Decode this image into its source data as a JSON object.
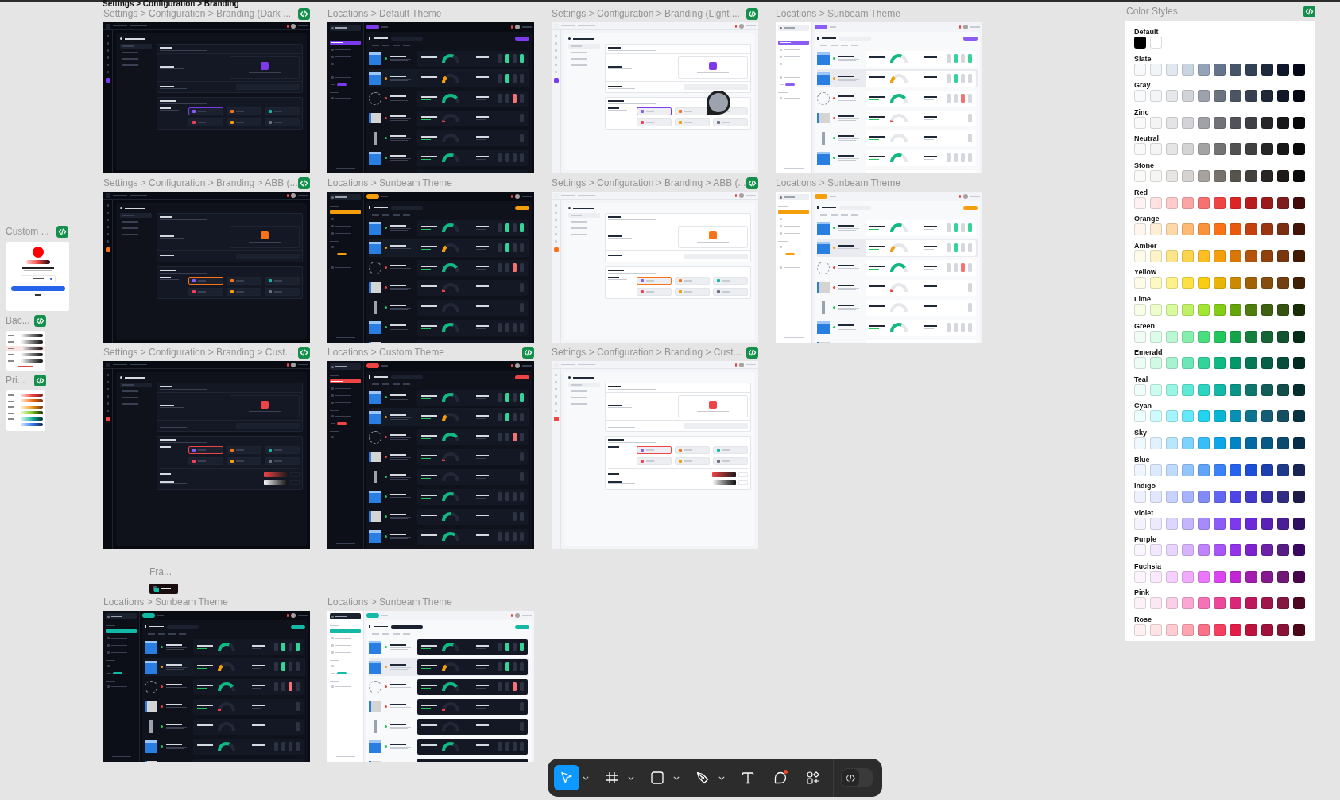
{
  "section_title": "Settings > Configuration > Branding",
  "rows": [
    {
      "frames": [
        {
          "title": "Settings > Configuration > Branding (Dark ...",
          "kind": "settings",
          "dark": true,
          "dark_cards": true,
          "color": "#7c3aed",
          "code": true,
          "collaborator": false,
          "extended": false
        },
        {
          "title": "Locations > Default Theme",
          "kind": "locations",
          "dark": true,
          "dark_cards": true,
          "color": "#7c3aed",
          "code": false,
          "collaborator": false,
          "extended": false
        },
        {
          "title": "Settings > Configuration > Branding (Light ...",
          "kind": "settings",
          "dark": false,
          "dark_cards": false,
          "color": "#7c3aed",
          "code": true,
          "collaborator": true,
          "extended": false
        },
        {
          "title": "Locations > Sunbeam Theme",
          "kind": "locations",
          "dark": false,
          "dark_cards": false,
          "color": "#8b5cf6",
          "code": false,
          "collaborator": false,
          "extended": false
        }
      ]
    },
    {
      "frames": [
        {
          "title": "Settings > Configuration > Branding > ABB (...",
          "kind": "settings",
          "dark": true,
          "dark_cards": true,
          "color": "#f97316",
          "code": true,
          "collaborator": false,
          "extended": false
        },
        {
          "title": "Locations > Sunbeam Theme",
          "kind": "locations",
          "dark": true,
          "dark_cards": true,
          "color": "#f59e0b",
          "code": false,
          "collaborator": false,
          "extended": false
        },
        {
          "title": "Settings > Configuration > Branding > ABB (...",
          "kind": "settings",
          "dark": false,
          "dark_cards": false,
          "color": "#f97316",
          "code": true,
          "collaborator": false,
          "extended": false
        },
        {
          "title": "Locations > Sunbeam Theme",
          "kind": "locations",
          "dark": false,
          "dark_cards": false,
          "color": "#f59e0b",
          "code": false,
          "collaborator": false,
          "extended": false
        }
      ]
    },
    {
      "frames": [
        {
          "title": "Settings > Configuration > Branding > Cust...",
          "kind": "settings",
          "dark": true,
          "dark_cards": true,
          "color": "#ef4444",
          "code": true,
          "collaborator": false,
          "extended": true
        },
        {
          "title": "Locations > Custom Theme",
          "kind": "locations",
          "dark": true,
          "dark_cards": true,
          "color": "#ef4444",
          "code": true,
          "collaborator": false,
          "extended": true
        },
        {
          "title": "Settings > Configuration > Branding > Cust...",
          "kind": "settings",
          "dark": false,
          "dark_cards": false,
          "color": "#ef4444",
          "code": true,
          "collaborator": false,
          "extended": true
        }
      ]
    },
    {
      "frames": [
        {
          "title": "Locations > Sunbeam Theme",
          "kind": "locations",
          "dark": true,
          "dark_cards": true,
          "color": "#14b8a6",
          "code": false,
          "collaborator": false,
          "extended": false
        },
        {
          "title": "Locations > Sunbeam Theme",
          "kind": "locations",
          "dark": false,
          "dark_cards": true,
          "color": "#14b8a6",
          "code": false,
          "collaborator": false,
          "extended": false
        }
      ]
    }
  ],
  "component_frame": {
    "title": "Fra..."
  },
  "side_components": [
    {
      "title": "Custom ...",
      "kind": "color-picker",
      "code": true
    },
    {
      "title": "Bac...",
      "kind": "background-list",
      "code": true
    },
    {
      "title": "Pri...",
      "kind": "primary-list",
      "code": true
    }
  ],
  "color_styles": {
    "title": "Color Styles",
    "code": true,
    "rows": [
      {
        "label": "Default",
        "swatches": [
          {
            "color": "#000000"
          },
          {
            "color": "#ffffff"
          }
        ]
      },
      {
        "label": "Slate",
        "swatches": [
          {
            "color": "#f8fafc"
          },
          {
            "color": "#f1f5f9"
          },
          {
            "color": "#e2e8f0"
          },
          {
            "color": "#cbd5e1"
          },
          {
            "color": "#94a3b8"
          },
          {
            "color": "#64748b"
          },
          {
            "color": "#475569"
          },
          {
            "color": "#334155"
          },
          {
            "color": "#1e293b"
          },
          {
            "color": "#0f172a"
          },
          {
            "color": "#020617"
          }
        ]
      },
      {
        "label": "Gray",
        "swatches": [
          {
            "color": "#f9fafb"
          },
          {
            "color": "#f3f4f6"
          },
          {
            "color": "#e5e7eb"
          },
          {
            "color": "#d1d5db"
          },
          {
            "color": "#9ca3af"
          },
          {
            "color": "#6b7280"
          },
          {
            "color": "#4b5563"
          },
          {
            "color": "#374151"
          },
          {
            "color": "#1f2937"
          },
          {
            "color": "#111827"
          },
          {
            "color": "#030712"
          }
        ]
      },
      {
        "label": "Zinc",
        "swatches": [
          {
            "color": "#fafafa"
          },
          {
            "color": "#f4f4f5"
          },
          {
            "color": "#e4e4e7"
          },
          {
            "color": "#d4d4d8"
          },
          {
            "color": "#a1a1aa"
          },
          {
            "color": "#71717a"
          },
          {
            "color": "#52525b"
          },
          {
            "color": "#3f3f46"
          },
          {
            "color": "#27272a"
          },
          {
            "color": "#18181b"
          },
          {
            "color": "#09090b"
          }
        ]
      },
      {
        "label": "Neutral",
        "swatches": [
          {
            "color": "#fafafa"
          },
          {
            "color": "#f5f5f5"
          },
          {
            "color": "#e5e5e5"
          },
          {
            "color": "#d4d4d4"
          },
          {
            "color": "#a3a3a3"
          },
          {
            "color": "#737373"
          },
          {
            "color": "#525252"
          },
          {
            "color": "#404040"
          },
          {
            "color": "#262626"
          },
          {
            "color": "#171717"
          },
          {
            "color": "#0a0a0a"
          }
        ]
      },
      {
        "label": "Stone",
        "swatches": [
          {
            "color": "#fafaf9"
          },
          {
            "color": "#f5f5f4"
          },
          {
            "color": "#e7e5e4"
          },
          {
            "color": "#d6d3d1"
          },
          {
            "color": "#a8a29e"
          },
          {
            "color": "#78716c"
          },
          {
            "color": "#57534e"
          },
          {
            "color": "#44403c"
          },
          {
            "color": "#292524"
          },
          {
            "color": "#1c1917"
          },
          {
            "color": "#0c0a09"
          }
        ]
      },
      {
        "label": "Red",
        "swatches": [
          {
            "color": "#fef2f2"
          },
          {
            "color": "#fee2e2"
          },
          {
            "color": "#fecaca"
          },
          {
            "color": "#fca5a5"
          },
          {
            "color": "#f87171"
          },
          {
            "color": "#ef4444"
          },
          {
            "color": "#dc2626"
          },
          {
            "color": "#b91c1c"
          },
          {
            "color": "#991b1b"
          },
          {
            "color": "#7f1d1d"
          },
          {
            "color": "#450a0a"
          }
        ]
      },
      {
        "label": "Orange",
        "swatches": [
          {
            "color": "#fff7ed"
          },
          {
            "color": "#ffedd5"
          },
          {
            "color": "#fed7aa"
          },
          {
            "color": "#fdba74"
          },
          {
            "color": "#fb923c"
          },
          {
            "color": "#f97316"
          },
          {
            "color": "#ea580c"
          },
          {
            "color": "#c2410c"
          },
          {
            "color": "#9a3412"
          },
          {
            "color": "#7c2d12"
          },
          {
            "color": "#431407"
          }
        ]
      },
      {
        "label": "Amber",
        "swatches": [
          {
            "color": "#fffbeb"
          },
          {
            "color": "#fef3c7"
          },
          {
            "color": "#fde68a"
          },
          {
            "color": "#fcd34d"
          },
          {
            "color": "#fbbf24"
          },
          {
            "color": "#f59e0b"
          },
          {
            "color": "#d97706"
          },
          {
            "color": "#b45309"
          },
          {
            "color": "#92400e"
          },
          {
            "color": "#78350f"
          },
          {
            "color": "#451a03"
          }
        ]
      },
      {
        "label": "Yellow",
        "swatches": [
          {
            "color": "#fefce8"
          },
          {
            "color": "#fef9c3"
          },
          {
            "color": "#fef08a"
          },
          {
            "color": "#fde047"
          },
          {
            "color": "#facc15"
          },
          {
            "color": "#eab308"
          },
          {
            "color": "#ca8a04"
          },
          {
            "color": "#a16207"
          },
          {
            "color": "#854d0e"
          },
          {
            "color": "#713f12"
          },
          {
            "color": "#422006"
          }
        ]
      },
      {
        "label": "Lime",
        "swatches": [
          {
            "color": "#f7fee7"
          },
          {
            "color": "#ecfccb"
          },
          {
            "color": "#d9f99d"
          },
          {
            "color": "#bef264"
          },
          {
            "color": "#a3e635"
          },
          {
            "color": "#84cc16"
          },
          {
            "color": "#65a30d"
          },
          {
            "color": "#4d7c0f"
          },
          {
            "color": "#3f6212"
          },
          {
            "color": "#365314"
          },
          {
            "color": "#1a2e05"
          }
        ]
      },
      {
        "label": "Green",
        "swatches": [
          {
            "color": "#f0fdf4"
          },
          {
            "color": "#dcfce7"
          },
          {
            "color": "#bbf7d0"
          },
          {
            "color": "#86efac"
          },
          {
            "color": "#4ade80"
          },
          {
            "color": "#22c55e"
          },
          {
            "color": "#16a34a"
          },
          {
            "color": "#15803d"
          },
          {
            "color": "#166534"
          },
          {
            "color": "#14532d"
          },
          {
            "color": "#052e16"
          }
        ]
      },
      {
        "label": "Emerald",
        "swatches": [
          {
            "color": "#ecfdf5"
          },
          {
            "color": "#d1fae5"
          },
          {
            "color": "#a7f3d0"
          },
          {
            "color": "#6ee7b7"
          },
          {
            "color": "#34d399"
          },
          {
            "color": "#10b981"
          },
          {
            "color": "#059669"
          },
          {
            "color": "#047857"
          },
          {
            "color": "#065f46"
          },
          {
            "color": "#064e3b"
          },
          {
            "color": "#022c22"
          }
        ]
      },
      {
        "label": "Teal",
        "swatches": [
          {
            "color": "#f0fdfa"
          },
          {
            "color": "#ccfbf1"
          },
          {
            "color": "#99f6e4"
          },
          {
            "color": "#5eead4"
          },
          {
            "color": "#2dd4bf"
          },
          {
            "color": "#14b8a6"
          },
          {
            "color": "#0d9488"
          },
          {
            "color": "#0f766e"
          },
          {
            "color": "#115e59"
          },
          {
            "color": "#134e4a"
          },
          {
            "color": "#042f2e"
          }
        ]
      },
      {
        "label": "Cyan",
        "swatches": [
          {
            "color": "#ecfeff"
          },
          {
            "color": "#cffafe"
          },
          {
            "color": "#a5f3fc"
          },
          {
            "color": "#67e8f9"
          },
          {
            "color": "#22d3ee"
          },
          {
            "color": "#06b6d4"
          },
          {
            "color": "#0891b2"
          },
          {
            "color": "#0e7490"
          },
          {
            "color": "#155e75"
          },
          {
            "color": "#164e63"
          },
          {
            "color": "#083344"
          }
        ]
      },
      {
        "label": "Sky",
        "swatches": [
          {
            "color": "#f0f9ff"
          },
          {
            "color": "#e0f2fe"
          },
          {
            "color": "#bae6fd"
          },
          {
            "color": "#7dd3fc"
          },
          {
            "color": "#38bdf8"
          },
          {
            "color": "#0ea5e9"
          },
          {
            "color": "#0284c7"
          },
          {
            "color": "#0369a1"
          },
          {
            "color": "#075985"
          },
          {
            "color": "#0c4a6e"
          },
          {
            "color": "#082f49"
          }
        ]
      },
      {
        "label": "Blue",
        "swatches": [
          {
            "color": "#eff6ff"
          },
          {
            "color": "#dbeafe"
          },
          {
            "color": "#bfdbfe"
          },
          {
            "color": "#93c5fd"
          },
          {
            "color": "#60a5fa"
          },
          {
            "color": "#3b82f6"
          },
          {
            "color": "#2563eb"
          },
          {
            "color": "#1d4ed8"
          },
          {
            "color": "#1e40af"
          },
          {
            "color": "#1e3a8a"
          },
          {
            "color": "#172554"
          }
        ]
      },
      {
        "label": "Indigo",
        "swatches": [
          {
            "color": "#eef2ff"
          },
          {
            "color": "#e0e7ff"
          },
          {
            "color": "#c7d2fe"
          },
          {
            "color": "#a5b4fc"
          },
          {
            "color": "#818cf8"
          },
          {
            "color": "#6366f1"
          },
          {
            "color": "#4f46e5"
          },
          {
            "color": "#4338ca"
          },
          {
            "color": "#3730a3"
          },
          {
            "color": "#312e81"
          },
          {
            "color": "#1e1b4b"
          }
        ]
      },
      {
        "label": "Violet",
        "swatches": [
          {
            "color": "#f5f3ff"
          },
          {
            "color": "#ede9fe"
          },
          {
            "color": "#ddd6fe"
          },
          {
            "color": "#c4b5fd"
          },
          {
            "color": "#a78bfa"
          },
          {
            "color": "#8b5cf6"
          },
          {
            "color": "#7c3aed"
          },
          {
            "color": "#6d28d9"
          },
          {
            "color": "#5b21b6"
          },
          {
            "color": "#4c1d95"
          },
          {
            "color": "#2e1065"
          }
        ]
      },
      {
        "label": "Purple",
        "swatches": [
          {
            "color": "#faf5ff"
          },
          {
            "color": "#f3e8ff"
          },
          {
            "color": "#e9d5ff"
          },
          {
            "color": "#d8b4fe"
          },
          {
            "color": "#c084fc"
          },
          {
            "color": "#a855f7"
          },
          {
            "color": "#9333ea"
          },
          {
            "color": "#7e22ce"
          },
          {
            "color": "#6b21a8"
          },
          {
            "color": "#581c87"
          },
          {
            "color": "#3b0764"
          }
        ]
      },
      {
        "label": "Fuchsia",
        "swatches": [
          {
            "color": "#fdf4ff"
          },
          {
            "color": "#fae8ff"
          },
          {
            "color": "#f5d0fe"
          },
          {
            "color": "#f0abfc"
          },
          {
            "color": "#e879f9"
          },
          {
            "color": "#d946ef"
          },
          {
            "color": "#c026d3"
          },
          {
            "color": "#a21caf"
          },
          {
            "color": "#86198f"
          },
          {
            "color": "#701a75"
          },
          {
            "color": "#4a044e"
          }
        ]
      },
      {
        "label": "Pink",
        "swatches": [
          {
            "color": "#fdf2f8"
          },
          {
            "color": "#fce7f3"
          },
          {
            "color": "#fbcfe8"
          },
          {
            "color": "#f9a8d4"
          },
          {
            "color": "#f472b6"
          },
          {
            "color": "#ec4899"
          },
          {
            "color": "#db2777"
          },
          {
            "color": "#be185d"
          },
          {
            "color": "#9d174d"
          },
          {
            "color": "#831843"
          },
          {
            "color": "#500724"
          }
        ]
      },
      {
        "label": "Rose",
        "swatches": [
          {
            "color": "#fff1f2"
          },
          {
            "color": "#ffe4e6"
          },
          {
            "color": "#fecdd3"
          },
          {
            "color": "#fda4af"
          },
          {
            "color": "#fb7185"
          },
          {
            "color": "#f43f5e"
          },
          {
            "color": "#e11d48"
          },
          {
            "color": "#be123c"
          },
          {
            "color": "#9f1239"
          },
          {
            "color": "#881337"
          },
          {
            "color": "#4c0519"
          }
        ]
      }
    ]
  },
  "toolbar": {
    "tools": [
      {
        "kind": "move",
        "selected": true,
        "menu": true,
        "notification": false
      },
      {
        "kind": "frame",
        "selected": false,
        "menu": true,
        "notification": false
      },
      {
        "kind": "shape",
        "selected": false,
        "menu": true,
        "notification": false
      },
      {
        "kind": "pen",
        "selected": false,
        "menu": true,
        "notification": false
      },
      {
        "kind": "text",
        "selected": false,
        "menu": false,
        "notification": false
      },
      {
        "kind": "comment",
        "selected": false,
        "menu": false,
        "notification": true
      },
      {
        "kind": "actions",
        "selected": false,
        "menu": false,
        "notification": false
      }
    ],
    "dev_mode": {
      "on": false
    }
  }
}
